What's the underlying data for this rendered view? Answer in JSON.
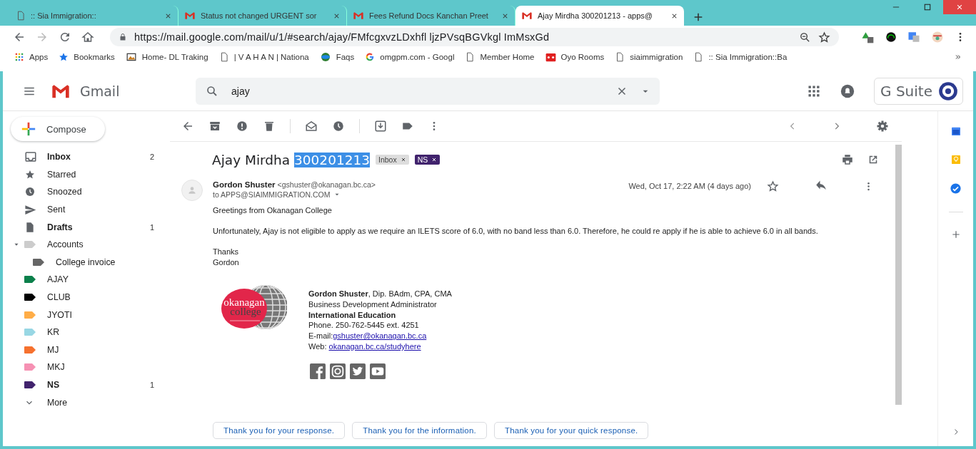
{
  "browser": {
    "tabs": [
      {
        "title": ":: Sia Immigration::",
        "kind": "page",
        "selected": false
      },
      {
        "title": "Status not changed URGENT sor",
        "kind": "gmail",
        "selected": false
      },
      {
        "title": "Fees Refund Docs Kanchan Preet",
        "kind": "gmail",
        "selected": false
      },
      {
        "title": "Ajay Mirdha 300201213 - apps@",
        "kind": "gmail",
        "selected": true
      }
    ],
    "url": "https://mail.google.com/mail/u/1/#search/ajay/FMfcgxvzLDxhfl ljzPVsqBGVkgl ImMsxGd",
    "bookmarks": [
      {
        "label": "Apps",
        "kind": "apps"
      },
      {
        "label": "Bookmarks",
        "kind": "star"
      },
      {
        "label": "Home- DL Traking",
        "kind": "image"
      },
      {
        "label": "| V A H A N | Nationa",
        "kind": "page"
      },
      {
        "label": "Faqs",
        "kind": "globe"
      },
      {
        "label": "omgpm.com - Googl",
        "kind": "google"
      },
      {
        "label": "Member Home",
        "kind": "page"
      },
      {
        "label": "Oyo Rooms",
        "kind": "oyo"
      },
      {
        "label": "siaimmigration",
        "kind": "page"
      },
      {
        "label": ":: Sia Immigration::Ba",
        "kind": "page"
      }
    ]
  },
  "header": {
    "product": "Gmail",
    "search": {
      "value": "ajay"
    },
    "gsuite": "G Suite"
  },
  "sidebar": {
    "compose": "Compose",
    "items": [
      {
        "label": "Inbox",
        "kind": "inbox",
        "count": "2",
        "bold": true
      },
      {
        "label": "Starred",
        "kind": "starred",
        "bold": false
      },
      {
        "label": "Snoozed",
        "kind": "snoozed",
        "bold": false
      },
      {
        "label": "Sent",
        "kind": "sent",
        "bold": false
      },
      {
        "label": "Drafts",
        "kind": "drafts",
        "count": "1",
        "bold": true
      },
      {
        "label": "Accounts",
        "kind": "label",
        "color": "#cccccc",
        "bold": false,
        "expanded": true,
        "children": [
          {
            "label": "College invoice",
            "kind": "label",
            "color": "#666666",
            "bold": false
          }
        ]
      },
      {
        "label": "AJAY",
        "kind": "label",
        "color": "#0b804b",
        "bold": false
      },
      {
        "label": "CLUB",
        "kind": "label",
        "color": "#000000",
        "bold": false
      },
      {
        "label": "JYOTI",
        "kind": "label",
        "color": "#ffad47",
        "bold": false
      },
      {
        "label": "KR",
        "kind": "label",
        "color": "#98d7e4",
        "bold": false
      },
      {
        "label": "MJ",
        "kind": "label",
        "color": "#f6712e",
        "bold": false
      },
      {
        "label": "MKJ",
        "kind": "label",
        "color": "#f691b3",
        "bold": false
      },
      {
        "label": "NS",
        "kind": "label",
        "color": "#41236d",
        "count": "1",
        "bold": true
      },
      {
        "label": "More",
        "kind": "more",
        "bold": false
      }
    ]
  },
  "email": {
    "subject_parts": [
      {
        "text": "Ajay Mirdha",
        "selected": false
      },
      {
        "text": "300201213",
        "selected": true
      }
    ],
    "labels": [
      {
        "text": "Inbox",
        "color": "#dddddd"
      },
      {
        "text": "NS",
        "color": "#41236d"
      }
    ],
    "sender": {
      "name": "Gordon Shuster",
      "address": "<gshuster@okanagan.bc.ca>"
    },
    "to": "to APPS@SIAIMMIGRATION.COM",
    "date": "Wed, Oct 17, 2:22 AM (4 days ago)",
    "body": [
      "Greetings from Okanagan College",
      "Unfortunately, Ajay is not eligible to apply as we require an ILETS score of 6.0, with no band less than 6.0.  Therefore, he could re apply if he is able to achieve 6.0 in all bands.",
      "Thanks\nGordon"
    ],
    "signature": {
      "logo": [
        "okanagan",
        "college"
      ],
      "lines": [
        {
          "kind": "plain",
          "text": "**Gordon Shuster**, Dip. BAdm, CPA, CMA"
        },
        {
          "kind": "plain",
          "text": "Business Development Administrator"
        },
        {
          "kind": "bold",
          "text": "International Education"
        },
        {
          "kind": "plain",
          "text": "Phone. 250-762-5445 ext. 4251"
        },
        {
          "kind": "link",
          "text": "E-mail:",
          "link": "gshuster@okanagan.bc.ca"
        },
        {
          "kind": "link",
          "text": "Web: ",
          "link": "okanagan.bc.ca/studyhere"
        }
      ]
    },
    "smart_replies": [
      "Thank you for your response.",
      "Thank you for the information.",
      "Thank you for your quick response."
    ]
  }
}
